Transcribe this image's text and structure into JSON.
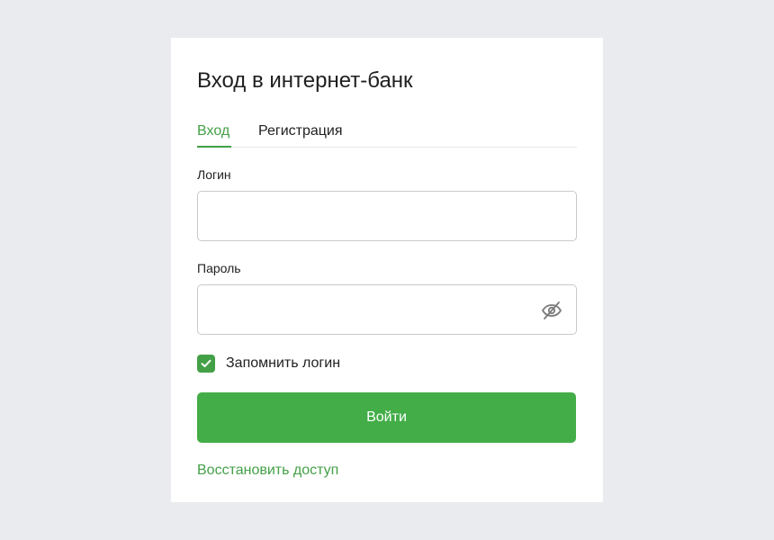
{
  "card": {
    "title": "Вход в интернет-банк"
  },
  "tabs": [
    {
      "label": "Вход",
      "active": true
    },
    {
      "label": "Регистрация",
      "active": false
    }
  ],
  "form": {
    "login_label": "Логин",
    "login_value": "",
    "login_placeholder": "",
    "password_label": "Пароль",
    "password_value": "",
    "password_placeholder": "",
    "password_toggle_icon": "eye-off-icon",
    "remember_label": "Запомнить логин",
    "remember_checked": true,
    "submit_label": "Войти",
    "restore_label": "Восстановить доступ"
  },
  "colors": {
    "accent": "#43a047",
    "button": "#43ad47",
    "background": "#eaebee"
  }
}
